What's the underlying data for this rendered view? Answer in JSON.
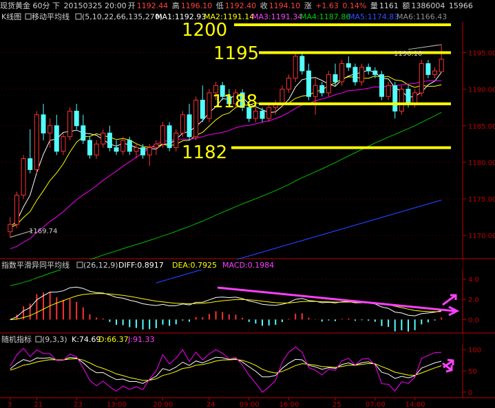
{
  "header": {
    "symbol": "现货黄金 60分 下",
    "datetime": "20150325 20:00",
    "open_label": "开",
    "open": "1192.44",
    "high_label": "高",
    "high": "1196.10",
    "low_label": "低",
    "low": "1192.40",
    "close_label": "收",
    "close": "1194.10",
    "change_label": "涨",
    "change": "+1.63",
    "change_pct": "0.14%",
    "volume_label": "量",
    "volume": "1161",
    "amount_label": "额",
    "amount": "1386004",
    "extra": "15966"
  },
  "ma_bar": {
    "chart_name": "K线图",
    "indicator": "移动平均线",
    "params": "(5,10,22,66,135,270)",
    "ma1": "MA1:1192.93",
    "ma2": "MA2:1191.14",
    "ma3": "MA3:1191.34",
    "ma4": "MA4:1187.86",
    "ma5": "MA5:1174.83",
    "ma6": "MA6:1166.43"
  },
  "macd_bar": {
    "name": "指数平滑异同平均线",
    "params": "(26,12,9)",
    "diff": "DIFF:0.8917",
    "dea": "DEA:0.7925",
    "macd": "MACD:0.1984"
  },
  "kdj_bar": {
    "name": "随机指标",
    "params": "(9,3,3)",
    "k": "K:74.69",
    "d": "D:66.37",
    "j": "J:91.33"
  },
  "annotations": {
    "level_1200": "1200",
    "level_1195": "1195",
    "level_1188": "1188",
    "level_1182": "1182",
    "low_marker": "1169.74",
    "high_marker": "1196.10"
  },
  "colors": {
    "up": "#ff3232",
    "down": "#54ffff",
    "ma1": "#ffffff",
    "ma2": "#ffff00",
    "ma3": "#ff00ff",
    "ma4": "#00c000",
    "ma5": "#2040ff",
    "ma6": "#808080",
    "level_line": "#ffff00",
    "trend_arrow": "#ff40ff",
    "axis": "#c00000"
  },
  "chart_data": [
    {
      "type": "candlestick",
      "title": "K线图",
      "ylim": [
        1167,
        1199
      ],
      "yticks": [
        1170.0,
        1175.0,
        1180.0,
        1185.0,
        1190.0,
        1195.0
      ],
      "xticks": [
        "3",
        "21",
        "23",
        "13:00",
        "20:00",
        "24",
        "09:00",
        "16:00",
        "25",
        "07:00",
        "14:00"
      ],
      "horizontal_levels": [
        1200,
        1195,
        1188,
        1182
      ],
      "annotated_low": 1169.74,
      "annotated_high": 1196.1,
      "series": [
        {
          "name": "MA1",
          "last": 1192.93
        },
        {
          "name": "MA2",
          "last": 1191.14
        },
        {
          "name": "MA3",
          "last": 1191.34
        },
        {
          "name": "MA4",
          "last": 1187.86
        },
        {
          "name": "MA5",
          "last": 1174.83
        },
        {
          "name": "MA6",
          "last": 1166.43
        }
      ],
      "candles": [
        [
          1170.5,
          1172.5,
          1169.7,
          1171.5
        ],
        [
          1171.5,
          1176.0,
          1171.0,
          1175.5
        ],
        [
          1175.5,
          1181.0,
          1175.0,
          1180.5
        ],
        [
          1180.5,
          1184.5,
          1178.5,
          1179.0
        ],
        [
          1179.0,
          1187.0,
          1178.5,
          1186.5
        ],
        [
          1186.5,
          1188.0,
          1183.0,
          1184.0
        ],
        [
          1184.0,
          1186.0,
          1182.0,
          1185.0
        ],
        [
          1185.0,
          1186.5,
          1181.0,
          1181.5
        ],
        [
          1181.5,
          1184.0,
          1181.0,
          1183.5
        ],
        [
          1183.5,
          1187.5,
          1183.0,
          1187.0
        ],
        [
          1187.0,
          1188.0,
          1184.5,
          1185.0
        ],
        [
          1185.0,
          1186.5,
          1182.5,
          1183.0
        ],
        [
          1183.0,
          1183.5,
          1180.5,
          1181.0
        ],
        [
          1181.0,
          1183.0,
          1180.5,
          1182.5
        ],
        [
          1182.5,
          1184.5,
          1182.0,
          1184.0
        ],
        [
          1184.0,
          1185.0,
          1181.5,
          1182.0
        ],
        [
          1182.0,
          1183.0,
          1181.0,
          1181.5
        ],
        [
          1181.5,
          1183.5,
          1181.0,
          1183.0
        ],
        [
          1183.0,
          1183.5,
          1181.0,
          1181.5
        ],
        [
          1181.5,
          1182.5,
          1180.5,
          1182.0
        ],
        [
          1182.0,
          1182.5,
          1180.5,
          1181.0
        ],
        [
          1181.0,
          1182.5,
          1179.5,
          1182.0
        ],
        [
          1182.0,
          1183.0,
          1181.0,
          1182.5
        ],
        [
          1182.5,
          1185.5,
          1182.0,
          1185.0
        ],
        [
          1185.0,
          1185.5,
          1181.5,
          1182.0
        ],
        [
          1182.0,
          1184.5,
          1181.5,
          1184.0
        ],
        [
          1184.0,
          1187.0,
          1183.5,
          1186.5
        ],
        [
          1186.5,
          1188.0,
          1183.0,
          1183.5
        ],
        [
          1183.5,
          1189.0,
          1183.0,
          1188.5
        ],
        [
          1188.5,
          1190.5,
          1185.5,
          1186.0
        ],
        [
          1186.0,
          1190.0,
          1185.5,
          1189.5
        ],
        [
          1189.5,
          1191.0,
          1188.5,
          1190.5
        ],
        [
          1190.5,
          1191.0,
          1188.5,
          1189.0
        ],
        [
          1189.0,
          1190.0,
          1187.5,
          1188.0
        ],
        [
          1188.0,
          1190.0,
          1187.5,
          1189.5
        ],
        [
          1189.5,
          1190.0,
          1187.0,
          1187.5
        ],
        [
          1187.5,
          1188.0,
          1185.5,
          1186.0
        ],
        [
          1186.0,
          1187.5,
          1185.5,
          1187.0
        ],
        [
          1187.0,
          1187.5,
          1185.5,
          1186.0
        ],
        [
          1186.0,
          1188.0,
          1185.5,
          1187.5
        ],
        [
          1187.5,
          1188.5,
          1186.5,
          1188.0
        ],
        [
          1188.0,
          1190.5,
          1187.5,
          1190.0
        ],
        [
          1190.0,
          1192.0,
          1189.5,
          1191.5
        ],
        [
          1191.5,
          1195.0,
          1191.0,
          1194.5
        ],
        [
          1194.5,
          1195.0,
          1192.0,
          1192.5
        ],
        [
          1192.5,
          1193.5,
          1188.5,
          1189.0
        ],
        [
          1189.0,
          1191.5,
          1186.5,
          1190.5
        ],
        [
          1190.5,
          1191.0,
          1189.0,
          1189.5
        ],
        [
          1189.5,
          1192.5,
          1189.0,
          1192.0
        ],
        [
          1192.0,
          1193.5,
          1190.5,
          1191.0
        ],
        [
          1191.0,
          1194.0,
          1190.5,
          1193.5
        ],
        [
          1193.5,
          1194.5,
          1192.5,
          1193.0
        ],
        [
          1193.0,
          1193.5,
          1190.5,
          1191.0
        ],
        [
          1191.0,
          1193.5,
          1190.5,
          1193.0
        ],
        [
          1193.0,
          1193.5,
          1192.0,
          1192.5
        ],
        [
          1192.5,
          1193.0,
          1191.5,
          1192.0
        ],
        [
          1192.0,
          1192.5,
          1188.5,
          1189.0
        ],
        [
          1189.0,
          1191.0,
          1188.5,
          1190.5
        ],
        [
          1190.5,
          1191.0,
          1186.0,
          1187.0
        ],
        [
          1187.0,
          1190.5,
          1186.5,
          1190.0
        ],
        [
          1190.0,
          1190.5,
          1187.5,
          1188.0
        ],
        [
          1188.0,
          1190.0,
          1187.5,
          1189.5
        ],
        [
          1189.5,
          1194.0,
          1189.0,
          1193.5
        ],
        [
          1193.5,
          1194.0,
          1191.5,
          1192.0
        ],
        [
          1192.0,
          1193.0,
          1191.5,
          1192.5
        ],
        [
          1192.4,
          1196.1,
          1192.4,
          1194.1
        ]
      ]
    },
    {
      "type": "line",
      "title": "指数平滑异同平均线",
      "ylim": [
        -1.2,
        4.8
      ],
      "yticks": [
        0.0,
        2.0,
        4.0
      ],
      "series": [
        {
          "name": "DIFF",
          "last": 0.8917
        },
        {
          "name": "DEA",
          "last": 0.7925
        },
        {
          "name": "MACD",
          "last": 0.1984
        }
      ]
    },
    {
      "type": "line",
      "title": "随机指标",
      "ylim": [
        -10,
        110
      ],
      "yticks": [
        0,
        50,
        100
      ],
      "series": [
        {
          "name": "K",
          "last": 74.69
        },
        {
          "name": "D",
          "last": 66.37
        },
        {
          "name": "J",
          "last": 91.33
        }
      ]
    }
  ]
}
